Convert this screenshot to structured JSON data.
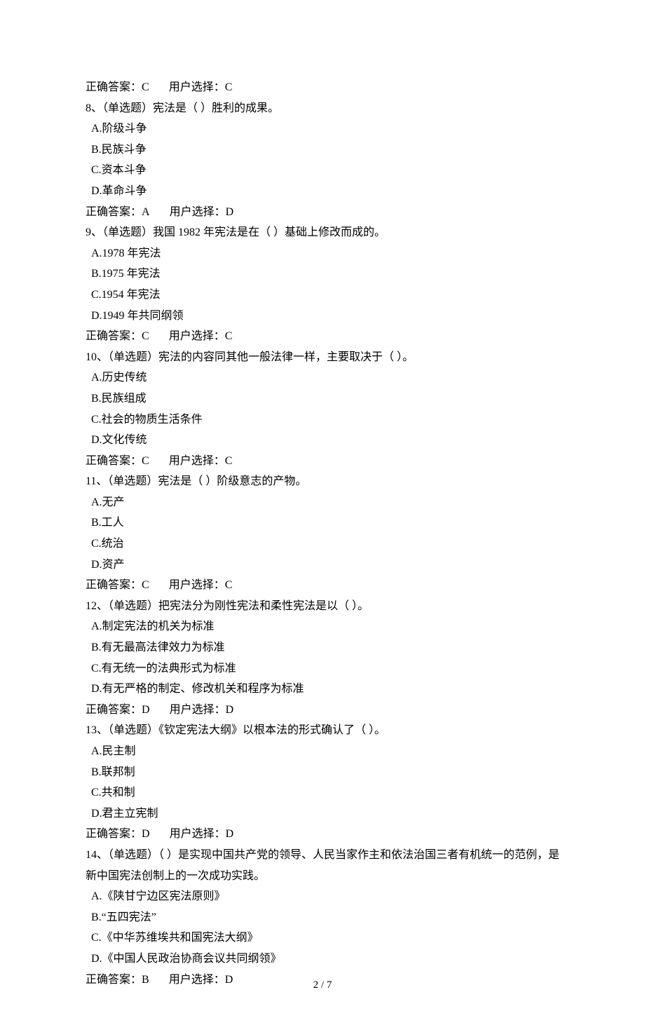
{
  "q7_answer": {
    "correct_label": "正确答案：",
    "correct_value": "C",
    "user_label": "用户选择：",
    "user_value": "C"
  },
  "q8": {
    "stem": "8、（单选题）宪法是（  ）胜利的成果。",
    "A": "A.阶级斗争",
    "B": "B.民族斗争",
    "C": "C.资本斗争",
    "D": "D.革命斗争",
    "correct_label": "正确答案：",
    "correct_value": "A",
    "user_label": "用户选择：",
    "user_value": "D"
  },
  "q9": {
    "stem": "9、（单选题）我国 1982 年宪法是在（  ）基础上修改而成的。",
    "A": "A.1978 年宪法",
    "B": "B.1975 年宪法",
    "C": "C.1954 年宪法",
    "D": "D.1949 年共同纲领",
    "correct_label": "正确答案：",
    "correct_value": "C",
    "user_label": "用户选择：",
    "user_value": "C"
  },
  "q10": {
    "stem": "10、（单选题）宪法的内容同其他一般法律一样，主要取决于（  ）。",
    "A": "A.历史传统",
    "B": "B.民族组成",
    "C": "C.社会的物质生活条件",
    "D": "D.文化传统",
    "correct_label": "正确答案：",
    "correct_value": "C",
    "user_label": "用户选择：",
    "user_value": "C"
  },
  "q11": {
    "stem": "11、（单选题）宪法是（  ）阶级意志的产物。",
    "A": "A.无产",
    "B": "B.工人",
    "C": "C.统治",
    "D": "D.资产",
    "correct_label": "正确答案：",
    "correct_value": "C",
    "user_label": "用户选择：",
    "user_value": "C"
  },
  "q12": {
    "stem": "12、（单选题）把宪法分为刚性宪法和柔性宪法是以（  ）。",
    "A": "A.制定宪法的机关为标准",
    "B": "B.有无最高法律效力为标准",
    "C": "C.有无统一的法典形式为标准",
    "D": "D.有无严格的制定、修改机关和程序为标准",
    "correct_label": "正确答案：",
    "correct_value": "D",
    "user_label": "用户选择：",
    "user_value": "D"
  },
  "q13": {
    "stem": "13、（单选题）《钦定宪法大纲》以根本法的形式确认了（  ）。",
    "A": "A.民主制",
    "B": "B.联邦制",
    "C": "C.共和制",
    "D": "D.君主立宪制",
    "correct_label": "正确答案：",
    "correct_value": "D",
    "user_label": "用户选择：",
    "user_value": "D"
  },
  "q14": {
    "stem": "14、（单选题）（  ）是实现中国共产党的领导、人民当家作主和依法治国三者有机统一的范例，是新中国宪法创制上的一次成功实践。",
    "A": "A.《陕甘宁边区宪法原则》",
    "B": "B.“五四宪法”",
    "C": "C.《中华苏维埃共和国宪法大纲》",
    "D": "D.《中国人民政治协商会议共同纲领》",
    "correct_label": "正确答案：",
    "correct_value": "B",
    "user_label": "用户选择：",
    "user_value": "D"
  },
  "page_number": "2 / 7"
}
